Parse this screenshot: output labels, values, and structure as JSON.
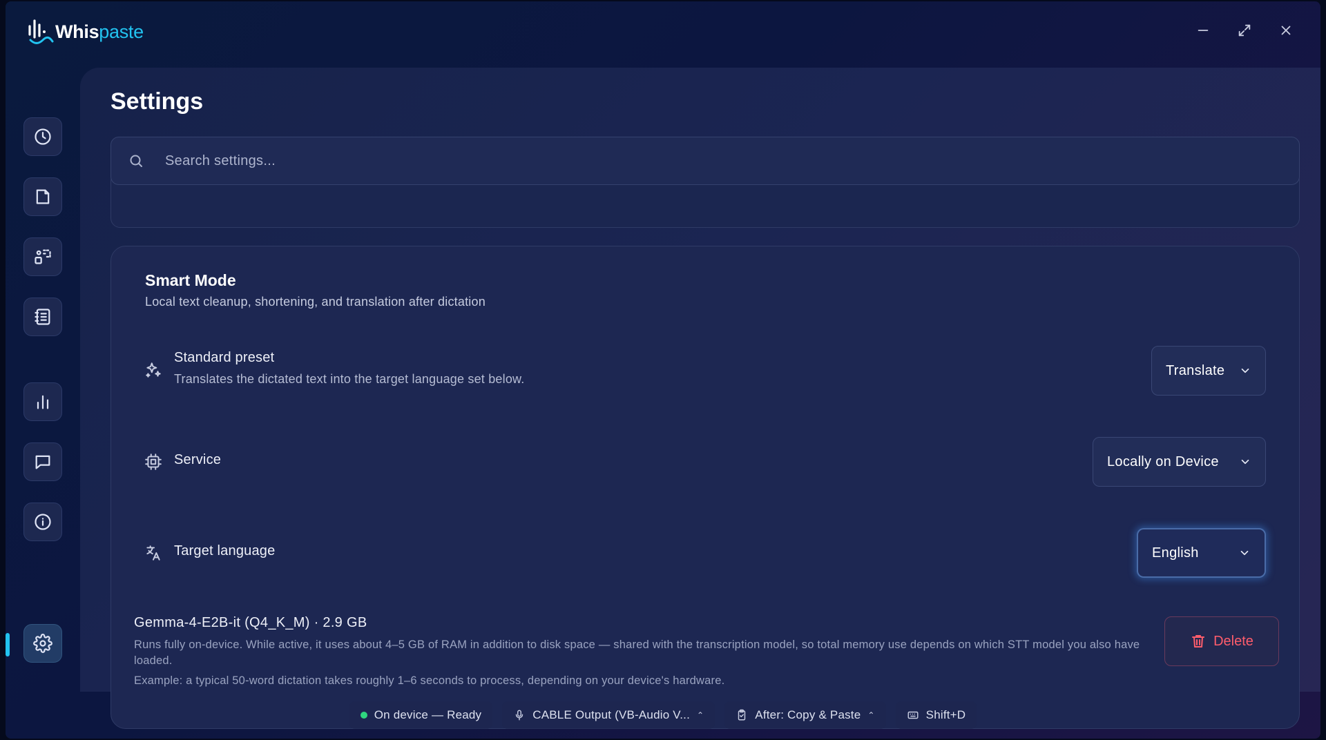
{
  "app": {
    "name_part1": "Whis",
    "name_part2": "paste",
    "accent_color": "#22c3f0"
  },
  "window_controls": {
    "minimize_icon": "minimize-icon",
    "maximize_icon": "maximize-icon",
    "close_icon": "close-icon"
  },
  "sidebar": {
    "items": [
      {
        "icon": "clock-icon",
        "label": "History"
      },
      {
        "icon": "file-icon",
        "label": "Files"
      },
      {
        "icon": "transform-icon",
        "label": "Transform"
      },
      {
        "icon": "notebook-icon",
        "label": "Notes"
      },
      {
        "icon": "bar-chart-icon",
        "label": "Statistics"
      },
      {
        "icon": "message-icon",
        "label": "Feedback"
      },
      {
        "icon": "info-icon",
        "label": "About"
      },
      {
        "icon": "gear-icon",
        "label": "Settings",
        "active": true
      }
    ]
  },
  "page": {
    "title": "Settings"
  },
  "search": {
    "placeholder": "Search settings..."
  },
  "smart_mode": {
    "title": "Smart Mode",
    "subtitle": "Local text cleanup, shortening, and translation after dictation",
    "preset": {
      "label": "Standard preset",
      "description": "Translates the dictated text into the target language set below.",
      "value": "Translate"
    },
    "service": {
      "label": "Service",
      "value": "Locally on Device"
    },
    "target_language": {
      "label": "Target language",
      "value": "English"
    },
    "model": {
      "title": "Gemma-4-E2B-it (Q4_K_M) · 2.9 GB",
      "description": "Runs fully on-device. While active, it uses about 4–5 GB of RAM in addition to disk space — shared with the transcription model, so total memory use depends on which STT model you also have loaded.",
      "example": "Example: a typical 50-word dictation takes roughly 1–6 seconds to process, depending on your device's hardware.",
      "delete_label": "Delete"
    }
  },
  "status_bar": {
    "status": {
      "text": "On device — Ready",
      "color": "#2fd67f"
    },
    "microphone": {
      "text": "CABLE Output (VB-Audio V..."
    },
    "after_action": {
      "text": "After: Copy & Paste"
    },
    "shortcut": {
      "text": "Shift+D"
    }
  }
}
